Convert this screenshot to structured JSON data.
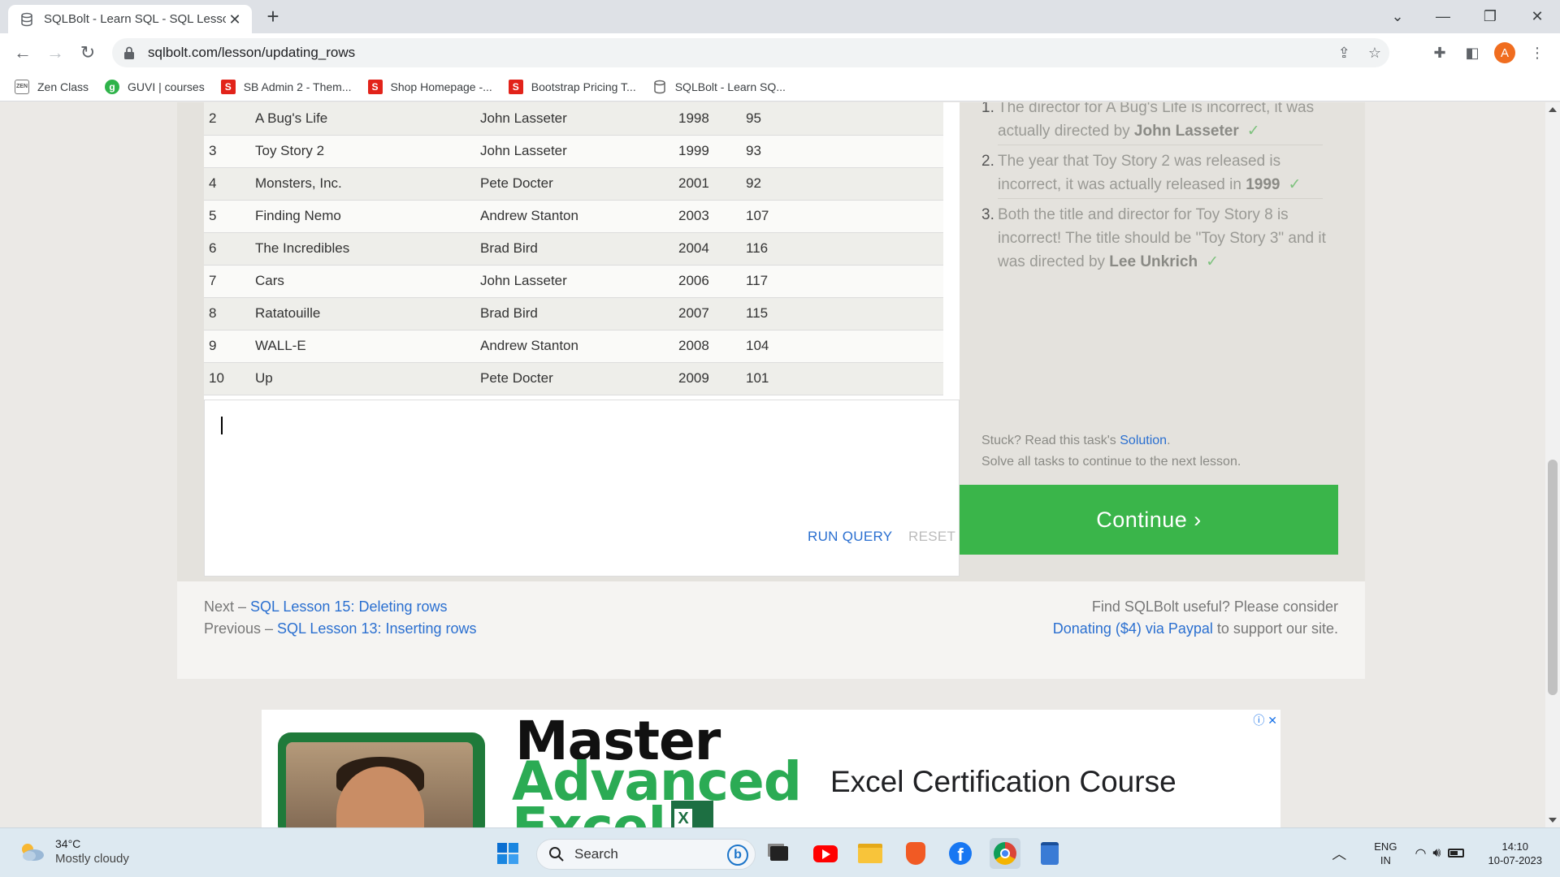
{
  "browser": {
    "tab_title": "SQLBolt - Learn SQL - SQL Lesson",
    "url": "sqlbolt.com/lesson/updating_rows",
    "profile_initial": "A",
    "bookmarks": [
      {
        "label": "Zen Class",
        "icon": "zen-class-icon"
      },
      {
        "label": "GUVI | courses",
        "icon": "guvi-icon"
      },
      {
        "label": "SB Admin 2 - Them...",
        "icon": "s-brand-icon"
      },
      {
        "label": "Shop Homepage -...",
        "icon": "s-brand-icon"
      },
      {
        "label": "Bootstrap Pricing T...",
        "icon": "s-brand-icon"
      },
      {
        "label": "SQLBolt - Learn SQ...",
        "icon": "database-icon"
      }
    ]
  },
  "results": {
    "rows": [
      [
        "2",
        "A Bug's Life",
        "John Lasseter",
        "1998",
        "95"
      ],
      [
        "3",
        "Toy Story 2",
        "John Lasseter",
        "1999",
        "93"
      ],
      [
        "4",
        "Monsters, Inc.",
        "Pete Docter",
        "2001",
        "92"
      ],
      [
        "5",
        "Finding Nemo",
        "Andrew Stanton",
        "2003",
        "107"
      ],
      [
        "6",
        "The Incredibles",
        "Brad Bird",
        "2004",
        "116"
      ],
      [
        "7",
        "Cars",
        "John Lasseter",
        "2006",
        "117"
      ],
      [
        "8",
        "Ratatouille",
        "Brad Bird",
        "2007",
        "115"
      ],
      [
        "9",
        "WALL-E",
        "Andrew Stanton",
        "2008",
        "104"
      ],
      [
        "10",
        "Up",
        "Pete Docter",
        "2009",
        "101"
      ]
    ]
  },
  "editor": {
    "run_label": "RUN QUERY",
    "reset_label": "RESET"
  },
  "tasks": {
    "items": [
      {
        "num": "1.",
        "text": "The director for A Bug's Life is incorrect, it was actually directed by ",
        "bold": "John Lasseter",
        "check": "✓"
      },
      {
        "num": "2.",
        "text": "The year that Toy Story 2 was released is incorrect, it was actually released in ",
        "bold": "1999",
        "check": "✓"
      },
      {
        "num": "3.",
        "text": "Both the title and director for Toy Story 8 is incorrect! The title should be \"Toy Story 3\" and it was directed by ",
        "bold": "Lee Unkrich",
        "check": "✓"
      }
    ],
    "stuck_prefix": "Stuck? Read this task's ",
    "solution_link": "Solution",
    "stuck_suffix": ".",
    "solve_all": "Solve all tasks to continue to the next lesson.",
    "continue_label": "Continue ›"
  },
  "footer": {
    "next_prefix": "Next – ",
    "next_link": "SQL Lesson 15: Deleting rows",
    "prev_prefix": "Previous – ",
    "prev_link": "SQL Lesson 13: Inserting rows",
    "useful_text": "Find SQLBolt useful? Please consider",
    "donate_link": "Donating ($4) via Paypal",
    "donate_suffix": " to support our site."
  },
  "ad": {
    "line1": "Master",
    "line2": "Advanced",
    "line3": "Excel",
    "right_text": "Excel Certification Course",
    "close_icons": "ⓘ ✕"
  },
  "taskbar": {
    "temperature": "34°C",
    "weather": "Mostly cloudy",
    "search_label": "Search",
    "lang_line1": "ENG",
    "lang_line2": "IN",
    "time": "14:10",
    "date": "10-07-2023"
  },
  "colors": {
    "continue": "#3ab54a",
    "link": "#2a6fd0",
    "accent_profile": "#f06d1f"
  }
}
